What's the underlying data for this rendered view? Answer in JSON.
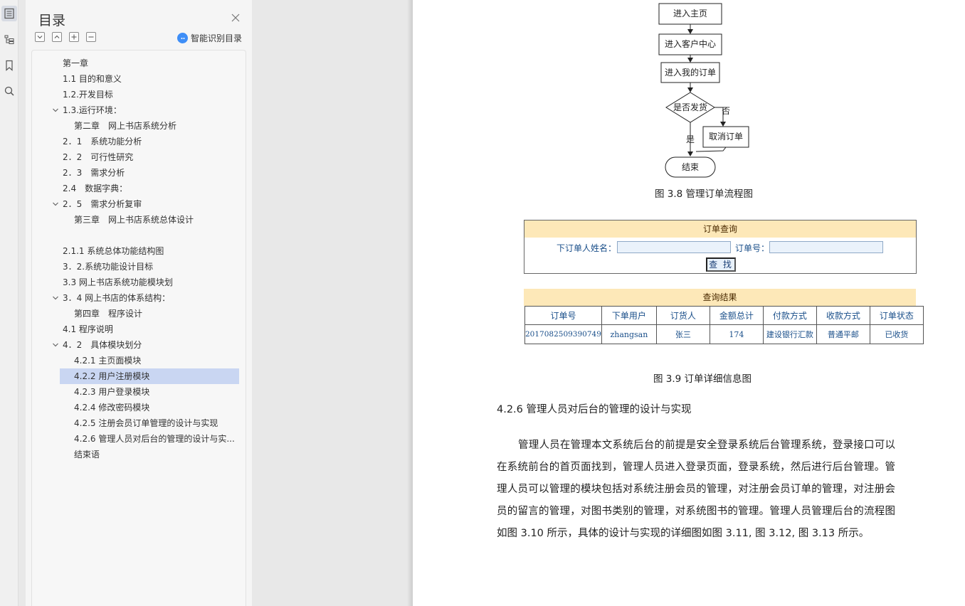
{
  "rail": {
    "icons": [
      "outline-icon",
      "toc-tree-icon",
      "bookmark-icon",
      "search-icon"
    ]
  },
  "toc": {
    "title": "目录",
    "smart_label": "智能识别目录",
    "items": [
      {
        "label": "第一章"
      },
      {
        "label": "1.1 目的和意义"
      },
      {
        "label": "1.2.开发目标"
      },
      {
        "label": "1.3.运行环境："
      },
      {
        "label": "第二章　网上书店系统分析"
      },
      {
        "label": "2．1　系统功能分析"
      },
      {
        "label": "2．2　可行性研究"
      },
      {
        "label": "2．3　需求分析"
      },
      {
        "label": "2.4　数据字典："
      },
      {
        "label": "2．5　需求分析复审"
      },
      {
        "label": "第三章　网上书店系统总体设计"
      },
      {
        "label": "2.1.1  系统总体功能结构图"
      },
      {
        "label": "3．2.系统功能设计目标"
      },
      {
        "label": "3.3  网上书店系统功能模块划"
      },
      {
        "label": "3．4  网上书店的体系结构："
      },
      {
        "label": "第四章　程序设计"
      },
      {
        "label": "4.1 程序说明"
      },
      {
        "label": "4．2　具体模块划分"
      },
      {
        "label": "4.2.1 主页面模块"
      },
      {
        "label": "4.2.2  用户注册模块"
      },
      {
        "label": "4.2.3  用户登录模块"
      },
      {
        "label": "4.2.4 修改密码模块"
      },
      {
        "label": "4.2.5 注册会员订单管理的设计与实现"
      },
      {
        "label": "4.2.6 管理人员对后台的管理的设计与实..."
      },
      {
        "label": "结束语"
      }
    ]
  },
  "doc": {
    "flow": {
      "enter_home": "进入主页",
      "enter_customer": "进入客户中心",
      "enter_orders": "进入我的订单",
      "shipped_q": "是否发货",
      "no": "否",
      "yes": "是",
      "cancel": "取消订单",
      "end": "结束"
    },
    "fig38_caption": "图 3.8 管理订单流程图",
    "query_form": {
      "header": "订单查询",
      "name_label": "下订单人姓名：",
      "order_no_label": "订单号：",
      "search_button": "查 找"
    },
    "results": {
      "header": "查询结果",
      "columns": [
        "订单号",
        "下单用户",
        "订货人",
        "金额总计",
        "付款方式",
        "收款方式",
        "订单状态"
      ],
      "rows": [
        [
          "2017082509390749",
          "zhangsan",
          "张三",
          "174",
          "建设银行汇款",
          "普通平邮",
          "已收货"
        ]
      ]
    },
    "fig39_caption": "图 3.9  订单详细信息图",
    "section_heading": "4.2.6 管理人员对后台的管理的设计与实现",
    "paragraph": "管理人员在管理本文系统后台的前提是安全登录系统后台管理系统，登录接口可以在系统前台的首页面找到，管理人员进入登录页面，登录系统，然后进行后台管理。管理人员可以管理的模块包括对系统注册会员的管理，对注册会员订单的管理，对注册会员的留言的管理，对图书类别的管理，对系统图书的管理。管理人员管理后台的流程图如图 3.10 所示，具体的设计与实现的详细图如图 3.11, 图 3.12, 图 3.13 所示。"
  }
}
